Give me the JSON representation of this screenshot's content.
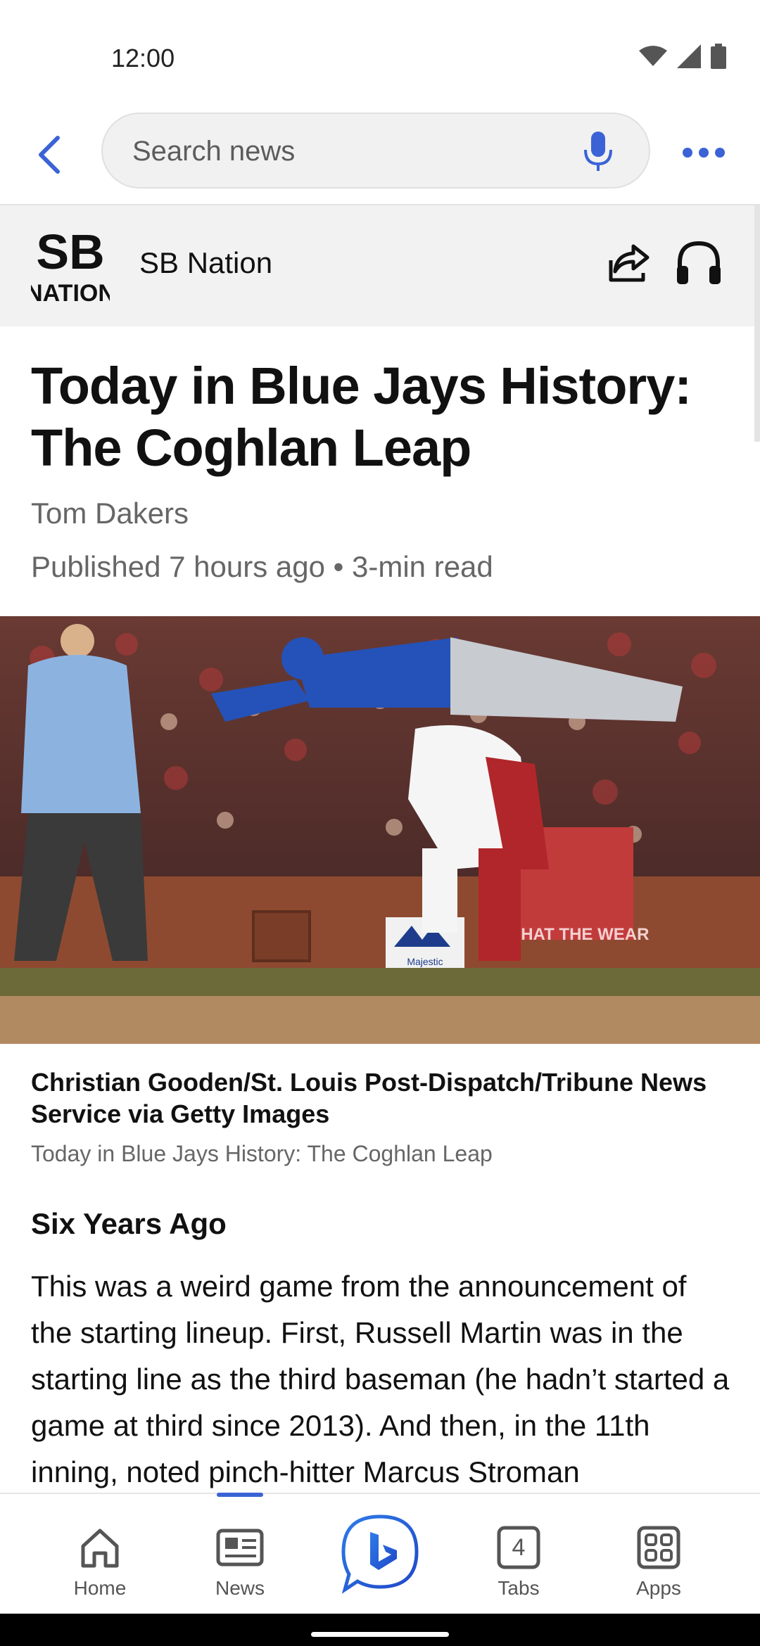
{
  "status_bar": {
    "time": "12:00"
  },
  "search": {
    "placeholder": "Search news"
  },
  "publisher": {
    "logo_text_top": "SB",
    "logo_text_bottom": "NATION",
    "name": "SB Nation"
  },
  "article": {
    "title": "Today in Blue Jays History: The Coghlan Leap",
    "author": "Tom Dakers",
    "meta": "Published 7 hours ago • 3-min read",
    "image": {
      "credit": "Christian Gooden/St. Louis Post-Dispatch/Tribune News Service via Getty Images",
      "caption": "Today in Blue Jays History: The Coghlan Leap",
      "sign_text": "Majestic",
      "banner_text": "WHAT THE WEAR"
    },
    "section_heading": "Six Years Ago",
    "body": "This was a weird game from the announcement of the starting lineup. First, Russell Martin was in the starting line as the third baseman (he hadn’t started a game at third since 2013). And then, in the 11th inning, noted pinch-hitter Marcus Stroman"
  },
  "bottom_nav": {
    "items": [
      {
        "label": "Home",
        "icon": "home-icon"
      },
      {
        "label": "News",
        "icon": "news-icon"
      },
      {
        "label": "",
        "icon": "bing-chat-icon"
      },
      {
        "label": "Tabs",
        "icon": "tabs-icon",
        "badge": "4"
      },
      {
        "label": "Apps",
        "icon": "apps-icon"
      }
    ],
    "active_index": 1
  },
  "colors": {
    "accent": "#3b63d6",
    "publisher_bar": "#f2f2f2",
    "muted_text": "#666666"
  }
}
